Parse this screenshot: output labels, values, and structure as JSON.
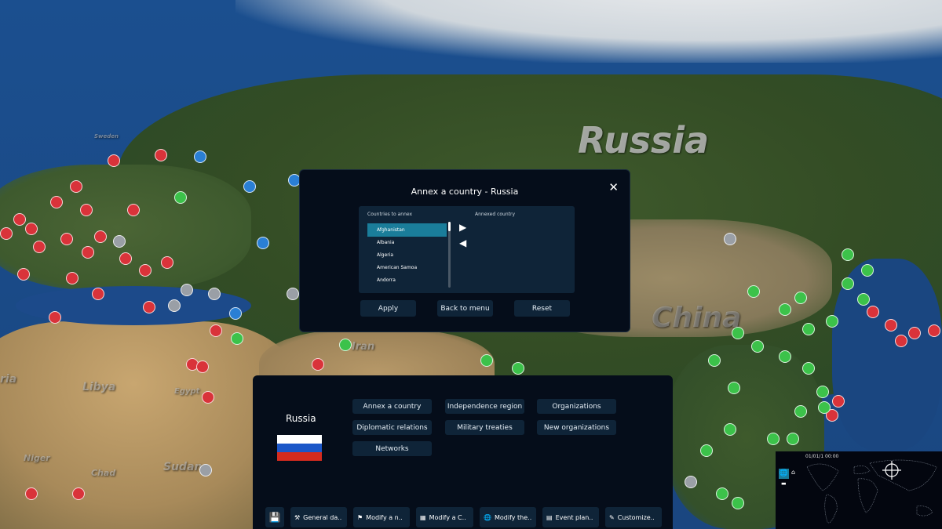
{
  "map": {
    "labels": [
      "Russia",
      "China",
      "Iran",
      "Libya",
      "Egypt",
      "Sudan",
      "Chad",
      "Niger",
      "Sweden",
      "ria"
    ],
    "marker_colors": {
      "red": "#d9333a",
      "green": "#3cc24a",
      "grey": "#9a9fa6",
      "blue": "#2a7fd4"
    }
  },
  "dialog": {
    "title": "Annex a country - Russia",
    "close_icon": "close-icon",
    "countries_to_annex_label": "Countries to annex",
    "annexed_country_label": "Annexed country",
    "countries": [
      "Afghanistan",
      "Albania",
      "Algeria",
      "American Samoa",
      "Andorra"
    ],
    "selected": "Afghanistan",
    "annexed": [],
    "add_icon": "arrow-right-icon",
    "remove_icon": "arrow-left-icon",
    "apply": "Apply",
    "back": "Back to menu",
    "reset": "Reset"
  },
  "country_panel": {
    "name": "Russia",
    "flag_colors": [
      "#ffffff",
      "#1c57c8",
      "#d52b1e"
    ],
    "buttons": [
      "Annex a country",
      "Independence region",
      "Organizations",
      "Diplomatic relations",
      "Military treaties",
      "New organizations",
      "Networks"
    ]
  },
  "toolbar": {
    "save_icon": "save-icon",
    "items": [
      {
        "label": "General da..",
        "icon": "tools-icon"
      },
      {
        "label": "Modify a n..",
        "icon": "flag-icon"
      },
      {
        "label": "Modify a C..",
        "icon": "buildings-icon"
      },
      {
        "label": "Modify the..",
        "icon": "globe-icon"
      },
      {
        "label": "Event plan..",
        "icon": "calendar-icon"
      },
      {
        "label": "Customize..",
        "icon": "user-edit-icon"
      }
    ]
  },
  "minimap": {
    "datetime": "01/01/1 00:00"
  }
}
